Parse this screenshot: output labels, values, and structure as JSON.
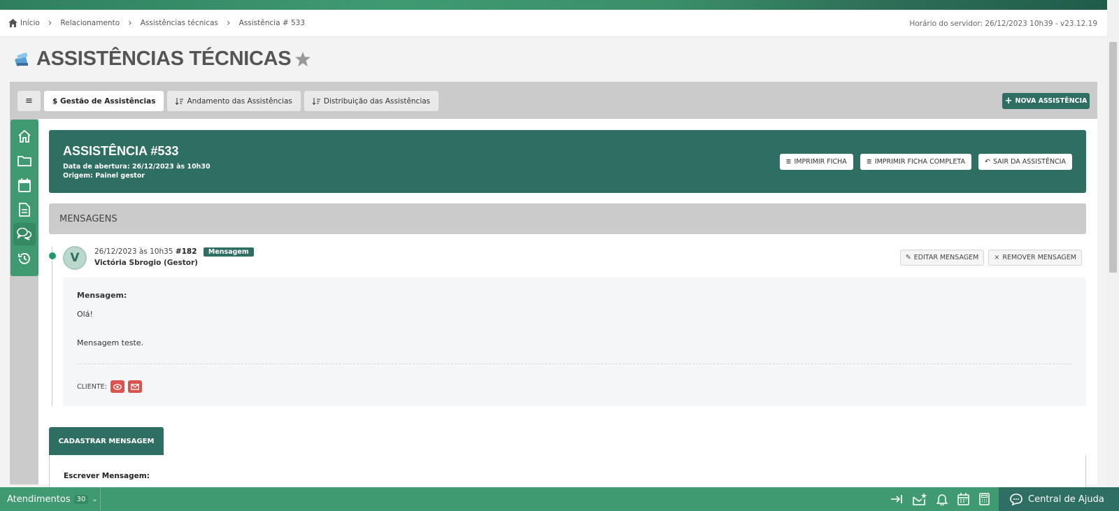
{
  "breadcrumb": {
    "items": [
      "Início",
      "Relacionamento",
      "Assistências técnicas",
      "Assistência # 533"
    ]
  },
  "server_time": "Horário do servidor: 26/12/2023 10h39 - v23.12.19",
  "page_title": "ASSISTÊNCIAS TÉCNICAS",
  "tabs": {
    "gestao": "$ Gestão de Assistências",
    "andamento": "Andamento das Assistências",
    "distribuicao": "Distribuição das Assistências"
  },
  "nova_button": "NOVA ASSISTÊNCIA",
  "header": {
    "title": "ASSISTÊNCIA #533",
    "opening": "Data de abertura: 26/12/2023 às 10h30",
    "origin": "Origem: Painel gestor",
    "btn_print": "IMPRIMIR FICHA",
    "btn_print_full": "IMPRIMIR FICHA COMPLETA",
    "btn_exit": "SAIR DA ASSISTÊNCIA"
  },
  "messages_title": "MENSAGENS",
  "message": {
    "avatar_letter": "V",
    "datetime": "26/12/2023 às 10h35",
    "number": "#182",
    "badge": "Mensagem",
    "author": "Victória Sbrogio (Gestor)",
    "edit_btn": "EDITAR MENSAGEM",
    "remove_btn": "REMOVER MENSAGEM",
    "label": "Mensagem:",
    "line1": "Olá!",
    "line2": "Mensagem teste.",
    "cliente_label": "CLIENTE:"
  },
  "cadastrar": {
    "tab": "CADASTRAR MENSAGEM",
    "label": "Escrever Mensagem:"
  },
  "bottom": {
    "atendimentos": "Atendimentos",
    "count": "30",
    "help": "Central de Ajuda"
  },
  "colors": {
    "primary": "#2e6e63",
    "green": "#3f9a72",
    "danger": "#d9534f"
  }
}
